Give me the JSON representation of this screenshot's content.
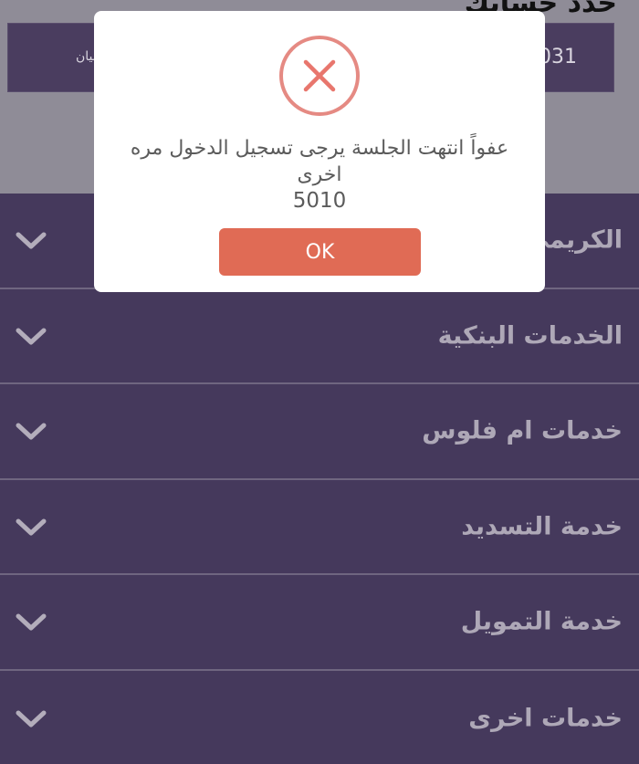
{
  "header": {
    "title": "حدد حسابك"
  },
  "account": {
    "number": "031",
    "name": "بيان"
  },
  "menu": {
    "items": [
      {
        "label": "الكريمي"
      },
      {
        "label": "الخدمات البنكية"
      },
      {
        "label": "خدمات ام فلوس"
      },
      {
        "label": "خدمة التسديد"
      },
      {
        "label": "خدمة التمويل"
      },
      {
        "label": "خدمات اخرى"
      }
    ]
  },
  "dialog": {
    "icon": "error-x-icon",
    "message": "عفواً انتهت الجلسة يرجى تسجيل الدخول مره اخرى",
    "code": "5010",
    "ok_label": "OK"
  },
  "colors": {
    "menu_bg": "#45395c",
    "dialog_button": "#e06b55",
    "error_icon": "#e58a83"
  }
}
